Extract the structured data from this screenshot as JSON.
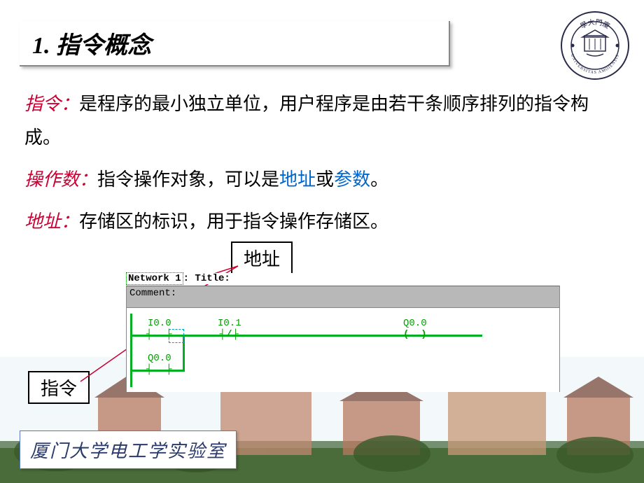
{
  "title": "1. 指令概念",
  "para1": {
    "label": "指令：",
    "text": "是程序的最小独立单位，用户程序是由若干条顺序排列的指令构成。"
  },
  "para2": {
    "label": "操作数：",
    "pre": "指令操作对象，可以是",
    "addr": "地址",
    "mid": "或",
    "param": "参数",
    "end": "。"
  },
  "para3": {
    "label": "地址：",
    "text": "存储区的标识，用于指令操作存储区。"
  },
  "callouts": {
    "addr": "地址",
    "instr": "指令"
  },
  "ladder": {
    "network": "Network 1",
    "title_suffix": ": Title:",
    "comment": "Comment:",
    "I00": "I0.0",
    "I01": "I0.1",
    "Q00": "Q0.0",
    "Q00b": "Q0.0"
  },
  "footer": "厦门大学电工学实验室",
  "logo": {
    "outer": "UNIVERSITAS AMOIENSIS",
    "top_chars": "學大門廈"
  }
}
